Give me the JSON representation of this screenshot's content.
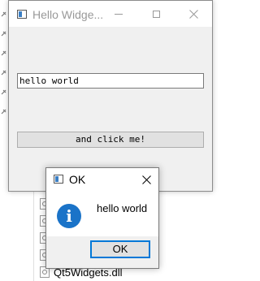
{
  "main_window": {
    "title": "Hello Widge...",
    "input_value": "hello world",
    "button_label": "and click me!"
  },
  "message_box": {
    "title": "OK",
    "message": "hello world",
    "ok_label": "OK"
  },
  "explorer": {
    "files": [
      "",
      "",
      "",
      "",
      "Qt5Widgets.dll"
    ]
  },
  "colors": {
    "info_icon": "#1a73c8",
    "focus_border": "#0078d7"
  }
}
